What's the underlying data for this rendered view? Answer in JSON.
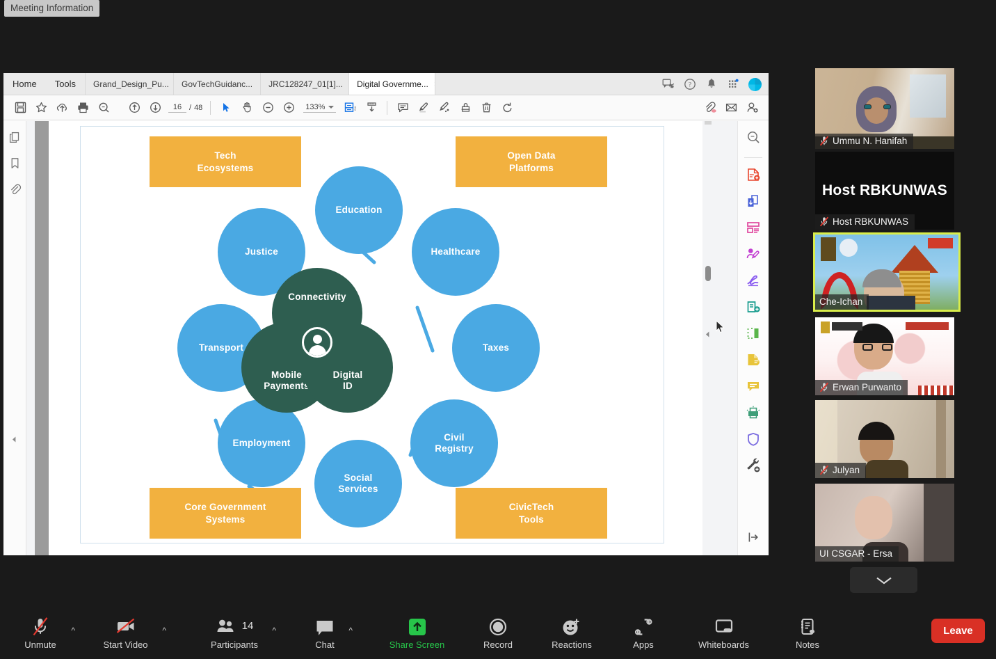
{
  "meeting_tooltip": "Meeting Information",
  "shared_app": {
    "menus": [
      {
        "label": "Home",
        "name": "menu-home"
      },
      {
        "label": "Tools",
        "name": "menu-tools"
      }
    ],
    "doc_tabs": [
      {
        "label": "Grand_Design_Pu...",
        "active": false
      },
      {
        "label": "GovTechGuidanc...",
        "active": false
      },
      {
        "label": "JRC128247_01[1]...",
        "active": false
      },
      {
        "label": "Digital Governme...",
        "active": true
      }
    ],
    "tab_close_glyph": "×",
    "top_right_icons": [
      "share-feedback-icon",
      "help-icon",
      "notifications-bell-icon",
      "app-switcher-icon",
      "account-avatar"
    ],
    "toolbar": {
      "icons_left": [
        "save-icon",
        "star-icon",
        "upload-cloud-icon",
        "print-icon",
        "search-icon"
      ],
      "page_up": "page-up-icon",
      "page_down": "page-down-icon",
      "page_current": "16",
      "page_separator": "/",
      "page_total": "48",
      "select_tool": "select-cursor-icon",
      "hand_tool": "hand-tool-icon",
      "zoom_out": "zoom-out-icon",
      "zoom_in": "zoom-in-icon",
      "zoom_value": "133%",
      "fit_tool": "fit-page-icon",
      "scroll_mode": "scroll-mode-icon",
      "icons_mid": [
        "comment-icon",
        "highlight-icon",
        "draw-icon",
        "stamp-icon",
        "delete-icon",
        "undo-icon"
      ],
      "icons_right": [
        "attach-link-icon",
        "email-icon",
        "add-person-icon"
      ]
    },
    "left_rail_icons": [
      "page-thumbnails-icon",
      "bookmarks-icon",
      "attachments-icon",
      "collapse-left-icon"
    ],
    "right_rail_icons": [
      "search-document-icon",
      "create-pdf-icon",
      "export-pdf-icon",
      "organize-pages-icon",
      "edit-pdf-icon",
      "fill-and-sign-icon",
      "comment-tools-icon",
      "combine-files-icon",
      "request-esignature-icon",
      "add-comment-icon",
      "compress-pdf-icon",
      "protect-icon",
      "more-tools-icon",
      "expand-panel-icon"
    ]
  },
  "diagram": {
    "outer_boxes": [
      {
        "label": "Tech\nEcosystems",
        "name": "box-tech-ecosystems"
      },
      {
        "label": "Open Data\nPlatforms",
        "name": "box-open-data-platforms"
      },
      {
        "label": "Core Government\nSystems",
        "name": "box-core-government-systems"
      },
      {
        "label": "CivicTech\nTools",
        "name": "box-civictech-tools"
      }
    ],
    "blue_nodes": [
      {
        "label": "Education",
        "name": "node-education"
      },
      {
        "label": "Healthcare",
        "name": "node-healthcare"
      },
      {
        "label": "Taxes",
        "name": "node-taxes"
      },
      {
        "label": "Civil\nRegistry",
        "name": "node-civil-registry"
      },
      {
        "label": "Social\nServices",
        "name": "node-social-services"
      },
      {
        "label": "Employment",
        "name": "node-employment"
      },
      {
        "label": "Transport",
        "name": "node-transport"
      },
      {
        "label": "Justice",
        "name": "node-justice"
      }
    ],
    "core_nodes": [
      {
        "label": "Connectivity",
        "name": "core-connectivity"
      },
      {
        "label": "Mobile\nPayments",
        "name": "core-mobile-payments"
      },
      {
        "label": "Digital\nID",
        "name": "core-digital-id"
      }
    ],
    "center_icon": "person-icon",
    "colors": {
      "orange": "#f2b13f",
      "blue": "#4aa9e3",
      "green": "#2e5e50"
    }
  },
  "participants": [
    {
      "name": "Ummu N. Hanifah",
      "muted": true,
      "selected": false,
      "kind": "video"
    },
    {
      "name": "Host RBKUNWAS",
      "muted": true,
      "selected": false,
      "kind": "name-only",
      "display_name": "Host RBKUNWAS"
    },
    {
      "name": "Che-Ichan",
      "muted": false,
      "selected": true,
      "kind": "video"
    },
    {
      "name": "Erwan Purwanto",
      "muted": true,
      "selected": false,
      "kind": "video"
    },
    {
      "name": "Julyan",
      "muted": true,
      "selected": false,
      "kind": "video"
    },
    {
      "name": "UI CSGAR - Ersa",
      "muted": false,
      "selected": false,
      "kind": "video"
    }
  ],
  "participants_scroll_icon": "chevron-down-icon",
  "zoombar": {
    "items": [
      {
        "label": "Unmute",
        "icon": "microphone-muted-icon",
        "caret": true,
        "name": "unmute-button",
        "muted_state": true
      },
      {
        "label": "Start Video",
        "icon": "video-muted-icon",
        "caret": true,
        "name": "start-video-button",
        "muted_state": true
      },
      {
        "label": "Participants",
        "icon": "participants-icon",
        "caret": true,
        "name": "participants-button",
        "count": "14"
      },
      {
        "label": "Chat",
        "icon": "chat-icon",
        "caret": true,
        "name": "chat-button"
      },
      {
        "label": "Share Screen",
        "icon": "share-screen-icon",
        "caret": false,
        "name": "share-screen-button",
        "highlight": "#27c54a"
      },
      {
        "label": "Record",
        "icon": "record-icon",
        "caret": false,
        "name": "record-button"
      },
      {
        "label": "Reactions",
        "icon": "reactions-icon",
        "caret": false,
        "name": "reactions-button"
      },
      {
        "label": "Apps",
        "icon": "apps-icon",
        "caret": false,
        "name": "apps-button"
      },
      {
        "label": "Whiteboards",
        "icon": "whiteboard-icon",
        "caret": false,
        "name": "whiteboards-button"
      },
      {
        "label": "Notes",
        "icon": "notes-icon",
        "caret": false,
        "name": "notes-button"
      }
    ],
    "leave_label": "Leave"
  }
}
